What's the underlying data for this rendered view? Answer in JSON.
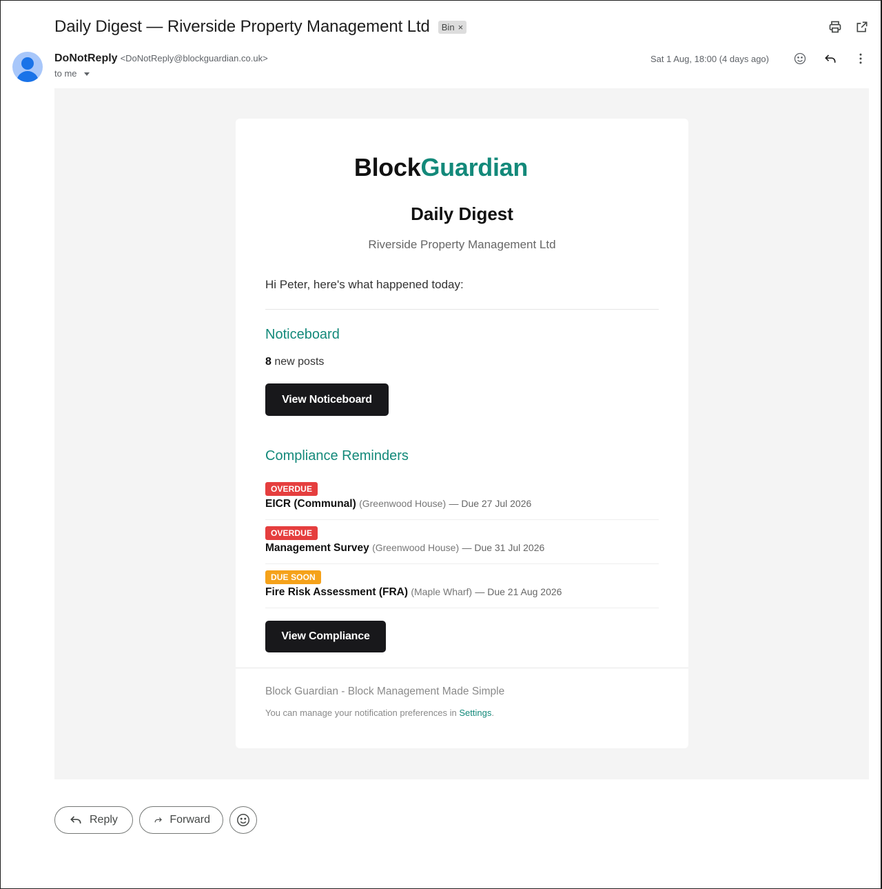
{
  "header": {
    "subject": "Daily Digest — Riverside Property Management Ltd",
    "label_chip": "Bin",
    "label_remove": "×",
    "icons": [
      "print-icon",
      "open-in-new-window-icon"
    ]
  },
  "sender": {
    "name": "DoNotReply",
    "email": "<DoNotReply@blockguardian.co.uk>",
    "to": "to me",
    "date": "Sat 1 Aug, 18:00 (4 days ago)"
  },
  "email": {
    "logo_part1": "Block",
    "logo_part2": "Guardian",
    "title": "Daily Digest",
    "subtitle": "Riverside Property Management Ltd",
    "greeting": "Hi Peter, here's what happened today:",
    "noticeboard": {
      "heading": "Noticeboard",
      "count": "8",
      "count_suffix": " new posts",
      "button": "View Noticeboard"
    },
    "compliance": {
      "heading": "Compliance Reminders",
      "items": [
        {
          "status": "OVERDUE",
          "name": "EICR (Communal)",
          "location": "(Greenwood House)",
          "due": "— Due 27 Jul 2026"
        },
        {
          "status": "OVERDUE",
          "name": "Management Survey",
          "location": "(Greenwood House)",
          "due": "— Due 31 Jul 2026"
        },
        {
          "status": "DUE SOON",
          "name": "Fire Risk Assessment (FRA)",
          "location": "(Maple Wharf)",
          "due": "— Due 21 Aug 2026"
        }
      ],
      "button": "View Compliance"
    },
    "footer": {
      "tagline": "Block Guardian - Block Management Made Simple",
      "note_prefix": "You can manage your notification preferences in ",
      "note_link": "Settings",
      "note_suffix": "."
    }
  },
  "actions": {
    "reply": "Reply",
    "forward": "Forward"
  },
  "colors": {
    "brand_teal": "#13897a",
    "overdue": "#e53e3e",
    "due_soon": "#f5a21a",
    "button_dark": "#18181b",
    "message_bg": "#f4f4f4"
  }
}
